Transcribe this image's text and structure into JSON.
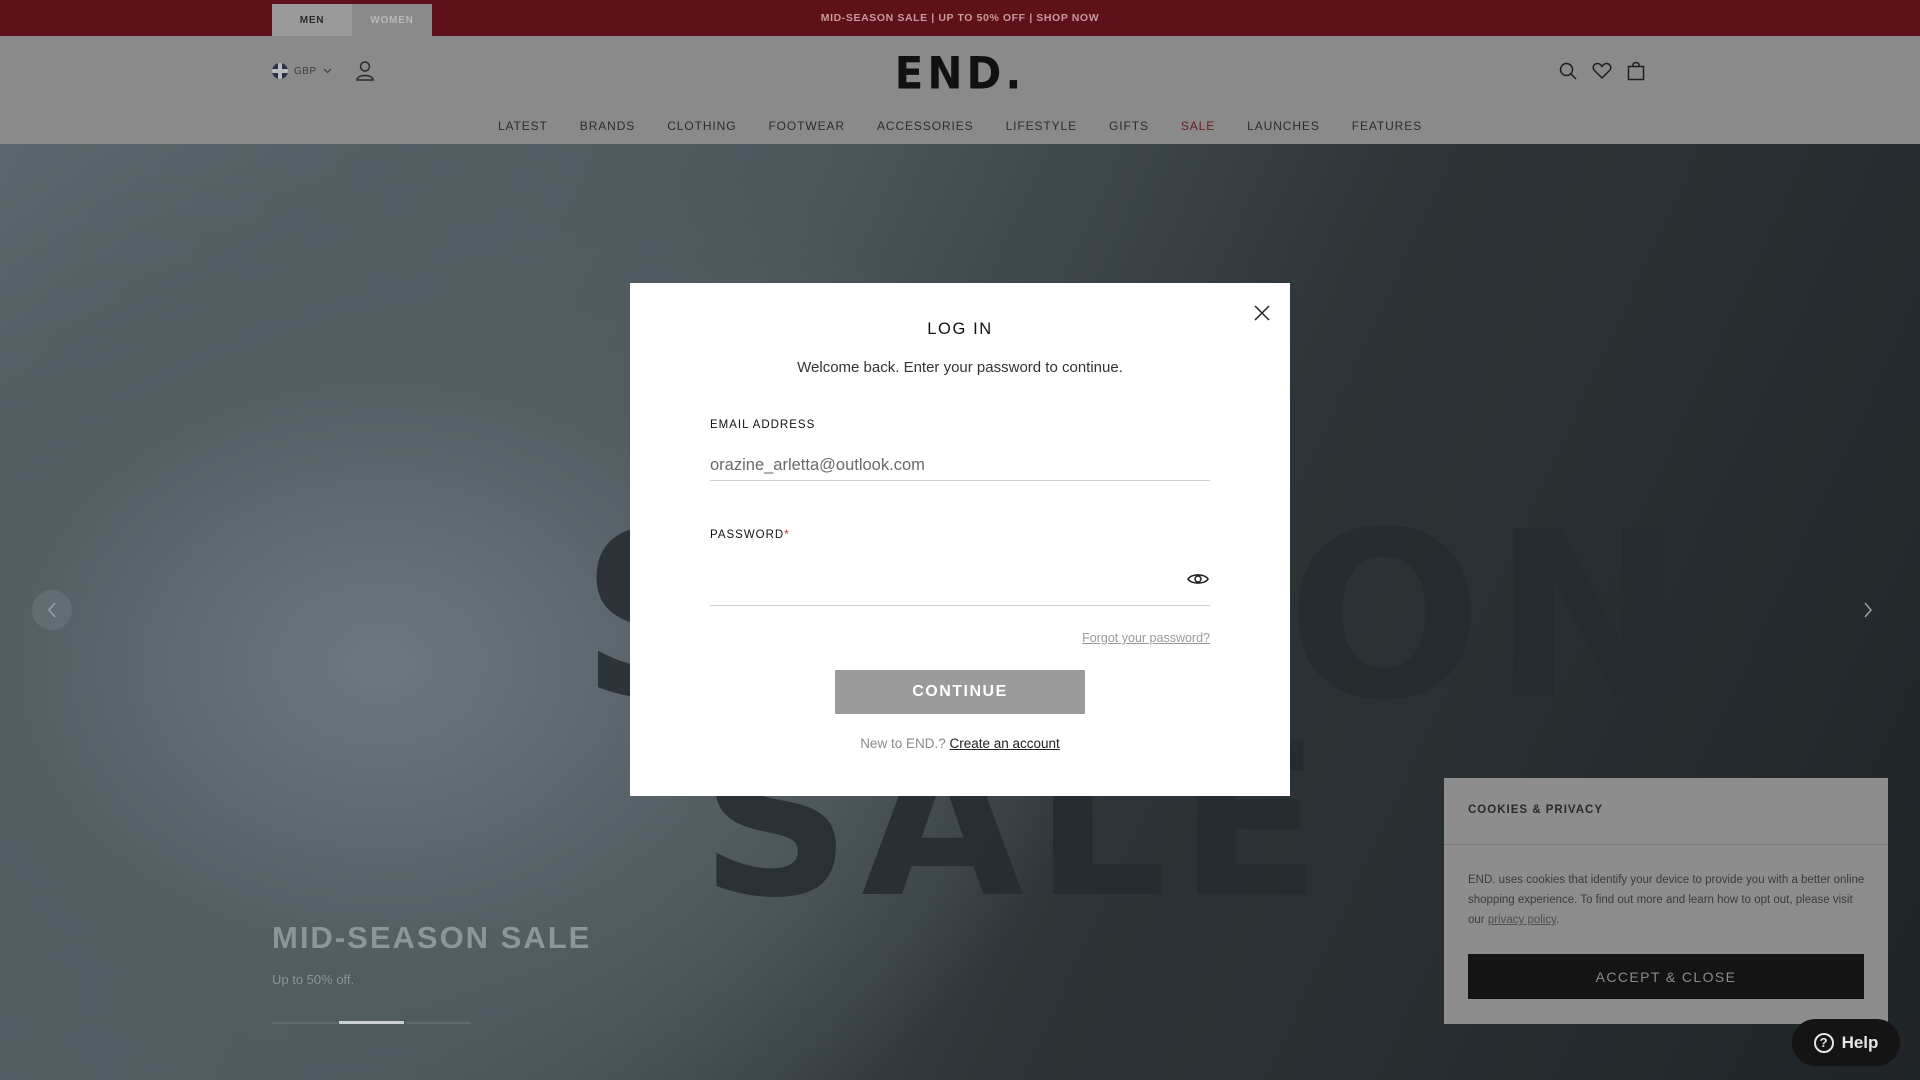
{
  "promo": {
    "tabs": [
      {
        "label": "MEN",
        "active": true
      },
      {
        "label": "WOMEN",
        "active": false
      }
    ],
    "text": "MID-SEASON SALE | UP TO 50% OFF | SHOP NOW"
  },
  "header": {
    "currency": "GBP",
    "logo": "END.",
    "icons": [
      "flag-uk-icon",
      "account-icon",
      "search-icon",
      "wishlist-heart-icon",
      "shopping-bag-icon"
    ]
  },
  "nav": {
    "items": [
      "LATEST",
      "BRANDS",
      "CLOTHING",
      "FOOTWEAR",
      "ACCESSORIES",
      "LIFESTYLE",
      "GIFTS",
      "SALE",
      "LAUNCHES",
      "FEATURES"
    ]
  },
  "hero": {
    "background_words": [
      "SEASON",
      "SALE"
    ],
    "title": "MID-SEASON SALE",
    "subtitle": "Up to 50% off.",
    "slides_total": 3,
    "slide_active": 2
  },
  "login_modal": {
    "title": "LOG IN",
    "subtitle": "Welcome back. Enter your password to continue.",
    "email_label": "EMAIL ADDRESS",
    "email_value": "orazine_arletta@outlook.com",
    "password_label": "PASSWORD",
    "password_required_mark": "*",
    "password_value": "",
    "forgot_link": "Forgot your password?",
    "continue_label": "CONTINUE",
    "new_prompt": "New to END.?",
    "create_link": "Create an account"
  },
  "cookie_panel": {
    "title": "COOKIES & PRIVACY",
    "text_before_link": "END. uses cookies that identify your device to provide you with a better online shopping experience. To find out more and learn how to opt out, please visit our ",
    "link": "privacy policy",
    "text_after_link": ".",
    "accept_label": "ACCEPT & CLOSE"
  },
  "help_button": {
    "label": "Help"
  },
  "colors": {
    "promo_bar": "#5e1118",
    "sale_nav": "#6b1a22",
    "continue_button": "#9b9b9b",
    "accept_button": "#141414"
  }
}
